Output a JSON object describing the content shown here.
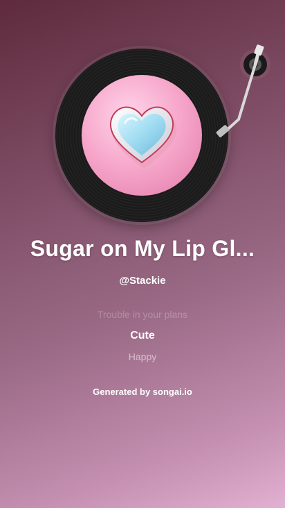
{
  "song": {
    "title": "Sugar on My Lip Gl...",
    "artist": "@Stackie"
  },
  "lyrics": {
    "previous": "Trouble in your plans",
    "current": "Cute",
    "next": "Happy"
  },
  "footer": {
    "text": "Generated by songai.io"
  },
  "icons": {
    "record": "vinyl-record-icon",
    "tonearm": "tonearm-icon",
    "cover": "heart-cover-art"
  },
  "colors": {
    "background_top": "#5e2a3c",
    "background_bottom": "#e2b0d2",
    "text": "#ffffff"
  }
}
